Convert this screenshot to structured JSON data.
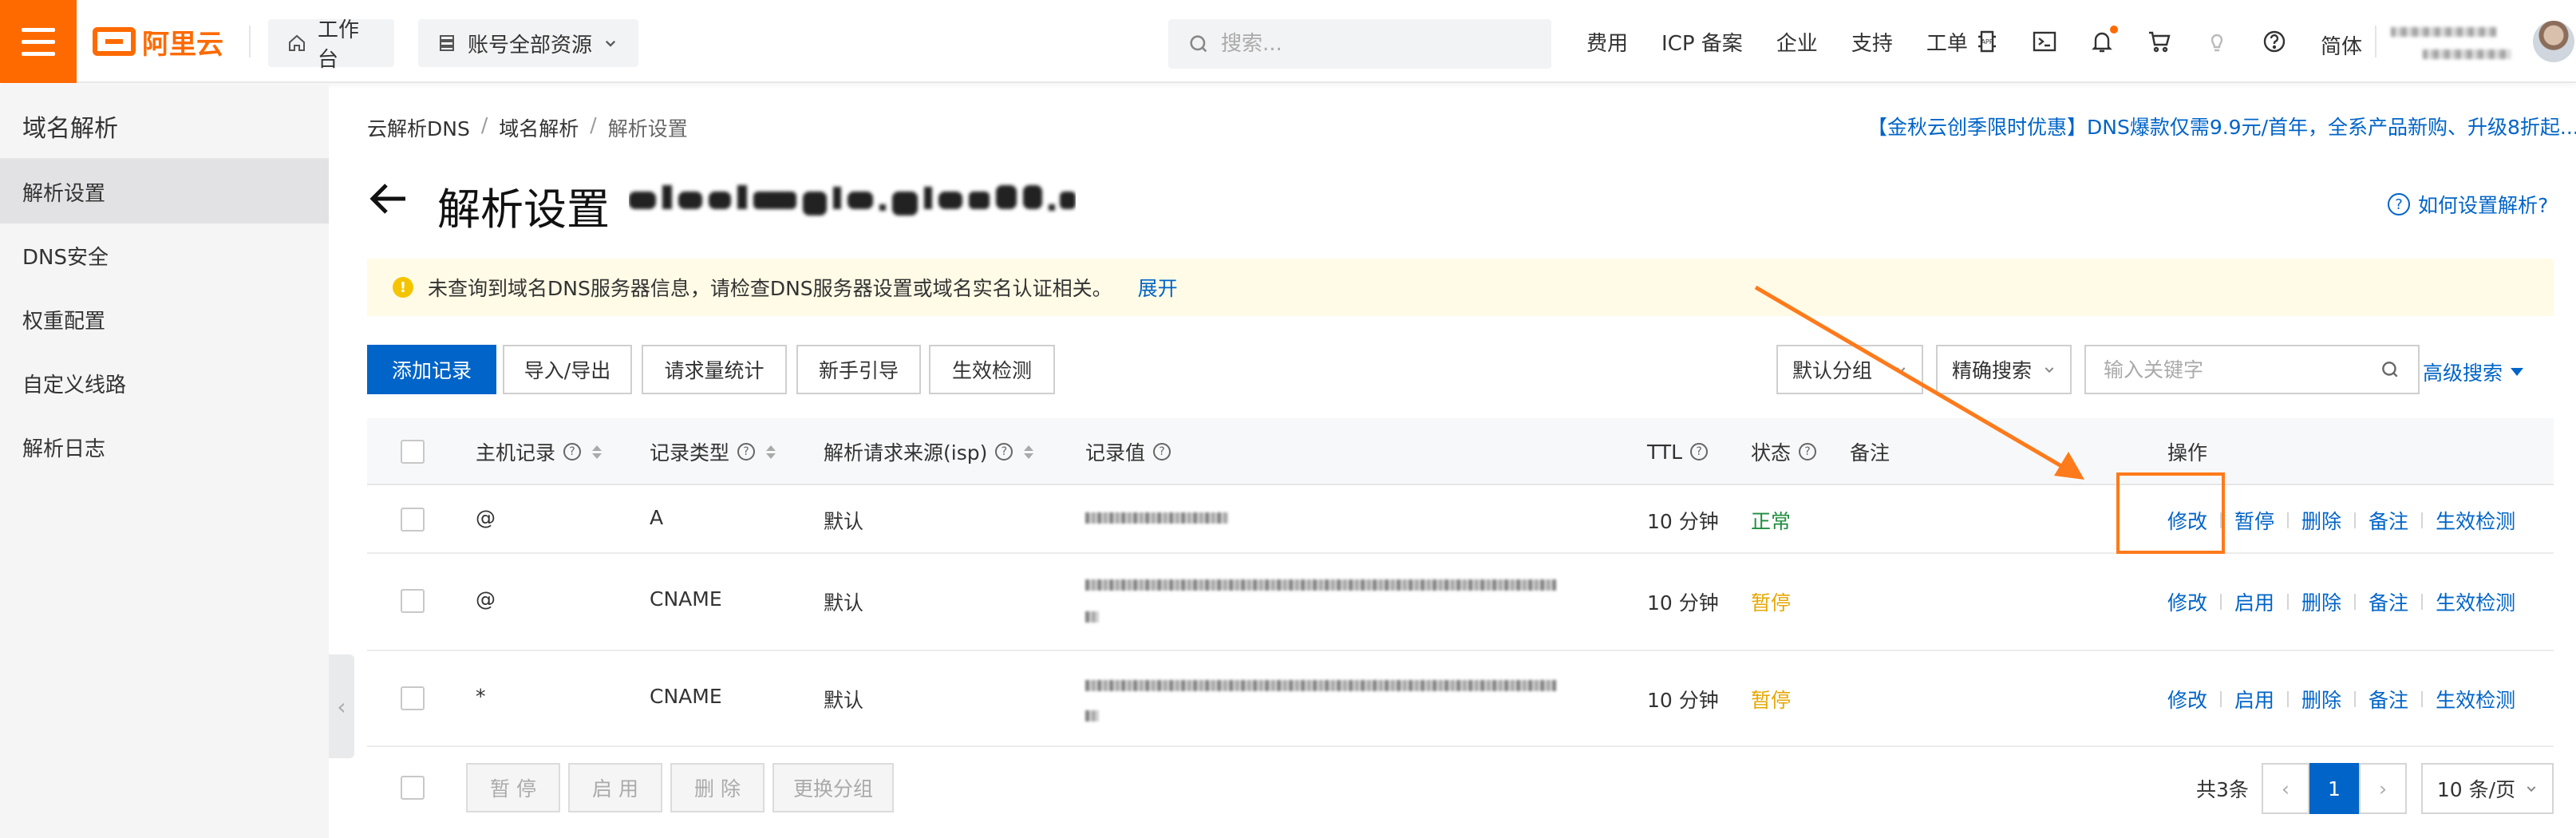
{
  "topbar": {
    "logo_text": "阿里云",
    "workbench_label": "工作台",
    "resources_label": "账号全部资源",
    "search_placeholder": "搜索...",
    "nav": [
      "费用",
      "ICP 备案",
      "企业",
      "支持",
      "工单"
    ],
    "lang_label": "简体",
    "icons": [
      "app-icon",
      "terminal-icon",
      "bell-icon",
      "cart-icon",
      "bulb-icon",
      "help-icon"
    ]
  },
  "sidebar": {
    "title": "域名解析",
    "items": [
      {
        "label": "解析设置",
        "active": true
      },
      {
        "label": "DNS安全"
      },
      {
        "label": "权重配置"
      },
      {
        "label": "自定义线路"
      },
      {
        "label": "解析日志"
      }
    ]
  },
  "breadcrumb": [
    "云解析DNS",
    "域名解析",
    "解析设置"
  ],
  "promo_text": "【金秋云创季限时优惠】DNS爆款仅需9.9元/首年，全系产品新购、升级8折起...",
  "page": {
    "title": "解析设置",
    "help_link": "如何设置解析?"
  },
  "alert": {
    "message": "未查询到域名DNS服务器信息，请检查DNS服务器设置或域名实名认证相关。",
    "expand_label": "展开"
  },
  "toolbar": {
    "add_record": "添加记录",
    "import_export": "导入/导出",
    "request_stats": "请求量统计",
    "guide": "新手引导",
    "check": "生效检测",
    "group_select": "默认分组",
    "search_mode": "精确搜索",
    "keyword_placeholder": "输入关键字",
    "advanced_search": "高级搜索"
  },
  "table": {
    "columns": [
      "主机记录",
      "记录类型",
      "解析请求来源(isp)",
      "记录值",
      "TTL",
      "状态",
      "备注",
      "操作"
    ],
    "rows": [
      {
        "host": "@",
        "type": "A",
        "isp": "默认",
        "ttl": "10 分钟",
        "status": "正常",
        "status_color": "#1e8e3e",
        "actions": [
          "修改",
          "暂停",
          "删除",
          "备注",
          "生效检测"
        ]
      },
      {
        "host": "@",
        "type": "CNAME",
        "isp": "默认",
        "ttl": "10 分钟",
        "status": "暂停",
        "status_color": "#e6a700",
        "actions": [
          "修改",
          "启用",
          "删除",
          "备注",
          "生效检测"
        ]
      },
      {
        "host": "*",
        "type": "CNAME",
        "isp": "默认",
        "ttl": "10 分钟",
        "status": "暂停",
        "status_color": "#e6a700",
        "actions": [
          "修改",
          "启用",
          "删除",
          "备注",
          "生效检测"
        ]
      }
    ]
  },
  "footer": {
    "batch_buttons": [
      "暂 停",
      "启 用",
      "删 除",
      "更换分组"
    ],
    "total": "共3条",
    "current_page": "1",
    "page_size": "10 条/页"
  },
  "colors": {
    "brand": "#ff6a00",
    "link": "#0064c8",
    "annotation": "#ff7a1a"
  }
}
